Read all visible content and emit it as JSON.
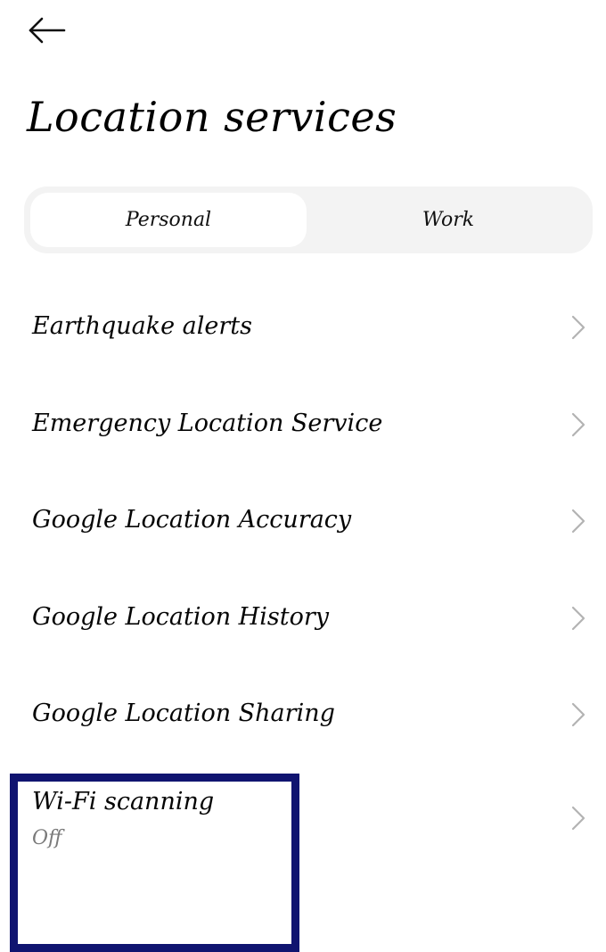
{
  "header": {
    "back_icon": "arrow-left-icon",
    "title": "Location services"
  },
  "tabs": [
    {
      "label": "Personal",
      "selected": true
    },
    {
      "label": "Work",
      "selected": false
    }
  ],
  "items": [
    {
      "label": "Earthquake alerts",
      "icon": "chevron-right-icon"
    },
    {
      "label": "Emergency Location Service",
      "icon": "chevron-right-icon"
    },
    {
      "label": "Google Location Accuracy",
      "icon": "chevron-right-icon"
    },
    {
      "label": "Google Location History",
      "icon": "chevron-right-icon"
    },
    {
      "label": "Google Location Sharing",
      "icon": "chevron-right-icon"
    },
    {
      "label": "Wi-Fi scanning",
      "sublabel": "Off",
      "icon": "chevron-right-icon"
    }
  ],
  "colors": {
    "highlight_border": "#101470",
    "chevron": "#b3b3b3",
    "segment_track": "#f3f3f3"
  }
}
